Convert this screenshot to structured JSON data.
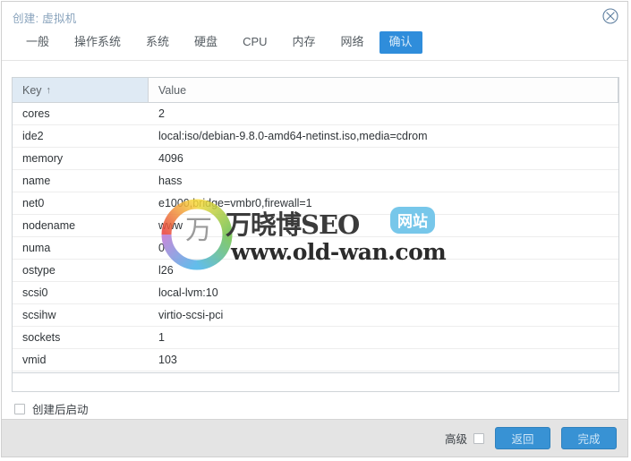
{
  "window": {
    "title": "创建: 虚拟机",
    "close_icon": "close-circle-icon"
  },
  "tabs": [
    {
      "label": "一般",
      "active": false
    },
    {
      "label": "操作系统",
      "active": false
    },
    {
      "label": "系统",
      "active": false
    },
    {
      "label": "硬盘",
      "active": false
    },
    {
      "label": "CPU",
      "active": false
    },
    {
      "label": "内存",
      "active": false
    },
    {
      "label": "网络",
      "active": false
    },
    {
      "label": "确认",
      "active": true
    }
  ],
  "grid": {
    "columns": [
      {
        "label": "Key",
        "sort": "↑",
        "sorted": true
      },
      {
        "label": "Value",
        "sort": "",
        "sorted": false
      }
    ],
    "rows": [
      {
        "key": "cores",
        "value": "2"
      },
      {
        "key": "ide2",
        "value": "local:iso/debian-9.8.0-amd64-netinst.iso,media=cdrom"
      },
      {
        "key": "memory",
        "value": "4096"
      },
      {
        "key": "name",
        "value": "hass"
      },
      {
        "key": "net0",
        "value": "e1000,bridge=vmbr0,firewall=1"
      },
      {
        "key": "nodename",
        "value": "www"
      },
      {
        "key": "numa",
        "value": "0"
      },
      {
        "key": "ostype",
        "value": "l26"
      },
      {
        "key": "scsi0",
        "value": "local-lvm:10"
      },
      {
        "key": "scsihw",
        "value": "virtio-scsi-pci"
      },
      {
        "key": "sockets",
        "value": "1"
      },
      {
        "key": "vmid",
        "value": "103"
      }
    ]
  },
  "options": {
    "start_after_create_label": "创建后启动",
    "start_after_create_checked": false,
    "advanced_label": "高级",
    "advanced_checked": false
  },
  "footer": {
    "back_label": "返回",
    "finish_label": "完成"
  },
  "watermark": {
    "logo_glyph": "万",
    "main_text": "万晓博SEO",
    "badge_text": "网站",
    "url_text": "www.old-wan.com"
  },
  "colors": {
    "accent": "#3892d4",
    "tab_active_bg": "#2f8ddb",
    "sorted_header_bg": "#dfeaf4",
    "footer_bg": "#e4e4e4",
    "title_text": "#8aa4bd"
  }
}
